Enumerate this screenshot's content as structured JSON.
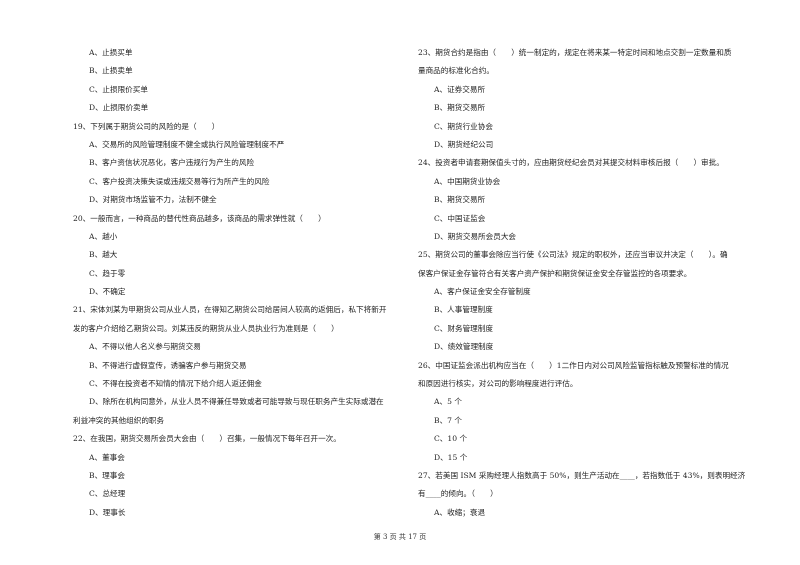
{
  "page": {
    "footer": "第 3 页 共 17 页"
  },
  "left_column": [
    {
      "type": "opt",
      "text": "A、止损买单"
    },
    {
      "type": "opt",
      "text": "B、止损卖单"
    },
    {
      "type": "opt",
      "text": "C、止损限价买单"
    },
    {
      "type": "opt",
      "text": "D、止损限价卖单"
    },
    {
      "type": "q",
      "text": "19、下列属于期货公司的风险的是（　　）"
    },
    {
      "type": "opt",
      "text": "A、交易所的风险管理制度不健全或执行风险管理制度不严"
    },
    {
      "type": "opt",
      "text": "B、客户资信状况恶化，客户违规行为产生的风险"
    },
    {
      "type": "opt",
      "text": "C、客户投资决策失误或违规交易等行为所产生的风险"
    },
    {
      "type": "opt",
      "text": "D、对期货市场监管不力，法制不健全"
    },
    {
      "type": "q",
      "text": "20、一般而言，一种商品的替代性商品越多，该商品的需求弹性就（　　）"
    },
    {
      "type": "opt",
      "text": "A、越小"
    },
    {
      "type": "opt",
      "text": "B、越大"
    },
    {
      "type": "opt",
      "text": "C、趋于零"
    },
    {
      "type": "opt",
      "text": "D、不确定"
    },
    {
      "type": "q",
      "text": "21、宋体刘某为甲期货公司从业人员，在得知乙期货公司给居间人较高的返佣后，私下将新开"
    },
    {
      "type": "cont",
      "text": "发的客户介绍给乙期货公司。刘某违反的期货从业人员执业行为准则是（　　）"
    },
    {
      "type": "opt",
      "text": "A、不得以他人名义参与期货交易"
    },
    {
      "type": "opt",
      "text": "B、不得进行虚假宣传，诱骗客户参与期货交易"
    },
    {
      "type": "opt",
      "text": "C、不得在投资者不知情的情况下给介绍人返还佣金"
    },
    {
      "type": "opt",
      "text": "D、除所在机构同意外，从业人员不得兼任导致或者可能导致与现任职务产生实际或潜在"
    },
    {
      "type": "cont",
      "text": "利益冲突的其他组织的职务"
    },
    {
      "type": "q",
      "text": "22、在我国，期货交易所会员大会由（　　）召集，一般情况下每年召开一次。"
    },
    {
      "type": "opt",
      "text": "A、董事会"
    },
    {
      "type": "opt",
      "text": "B、理事会"
    },
    {
      "type": "opt",
      "text": "C、总经理"
    },
    {
      "type": "opt",
      "text": "D、理事长"
    }
  ],
  "right_column": [
    {
      "type": "q",
      "text": "23、期货合约是指由（　　）统一制定的，规定在将来某一特定时间和地点交割一定数量和质"
    },
    {
      "type": "cont",
      "text": "量商品的标准化合约。"
    },
    {
      "type": "opt",
      "text": "A、证券交易所"
    },
    {
      "type": "opt",
      "text": "B、期货交易所"
    },
    {
      "type": "opt",
      "text": "C、期货行业协会"
    },
    {
      "type": "opt",
      "text": "D、期货经纪公司"
    },
    {
      "type": "q",
      "text": "24、投资者申请套期保值头寸的，应由期货经纪会员对其提交材料审核后报（　　）审批。"
    },
    {
      "type": "opt",
      "text": "A、中国期货业协会"
    },
    {
      "type": "opt",
      "text": "B、期货交易所"
    },
    {
      "type": "opt",
      "text": "C、中国证监会"
    },
    {
      "type": "opt",
      "text": "D、期货交易所会员大会"
    },
    {
      "type": "q",
      "text": "25、期货公司的董事会除应当行使《公司法》规定的职权外，还应当审议并决定（　　）。确"
    },
    {
      "type": "cont",
      "text": "保客户保证金存管符合有关客户资产保护和期货保证金安全存管监控的各项要求。"
    },
    {
      "type": "opt",
      "text": "A、客户保证金安全存管制度"
    },
    {
      "type": "opt",
      "text": "B、人事管理制度"
    },
    {
      "type": "opt",
      "text": "C、财务管理制度"
    },
    {
      "type": "opt",
      "text": "D、绩效管理制度"
    },
    {
      "type": "q",
      "text": "26、中国证监会派出机构应当在（　　）1二作日内对公司风险监管指标触及预警标准的情况"
    },
    {
      "type": "cont",
      "text": "和原因进行核实，对公司的影响程度进行评估。"
    },
    {
      "type": "opt",
      "text": "A、5 个"
    },
    {
      "type": "opt",
      "text": "B、7 个"
    },
    {
      "type": "opt",
      "text": "C、10 个"
    },
    {
      "type": "opt",
      "text": "D、15 个"
    },
    {
      "type": "q",
      "text": "27、若美国 ISM 采购经理人指数高于 50%，则生产活动在____，若指数低于 43%，则表明经济"
    },
    {
      "type": "cont",
      "text": "有____的倾向。（　　）"
    },
    {
      "type": "opt",
      "text": "A、收缩；衰退"
    }
  ]
}
